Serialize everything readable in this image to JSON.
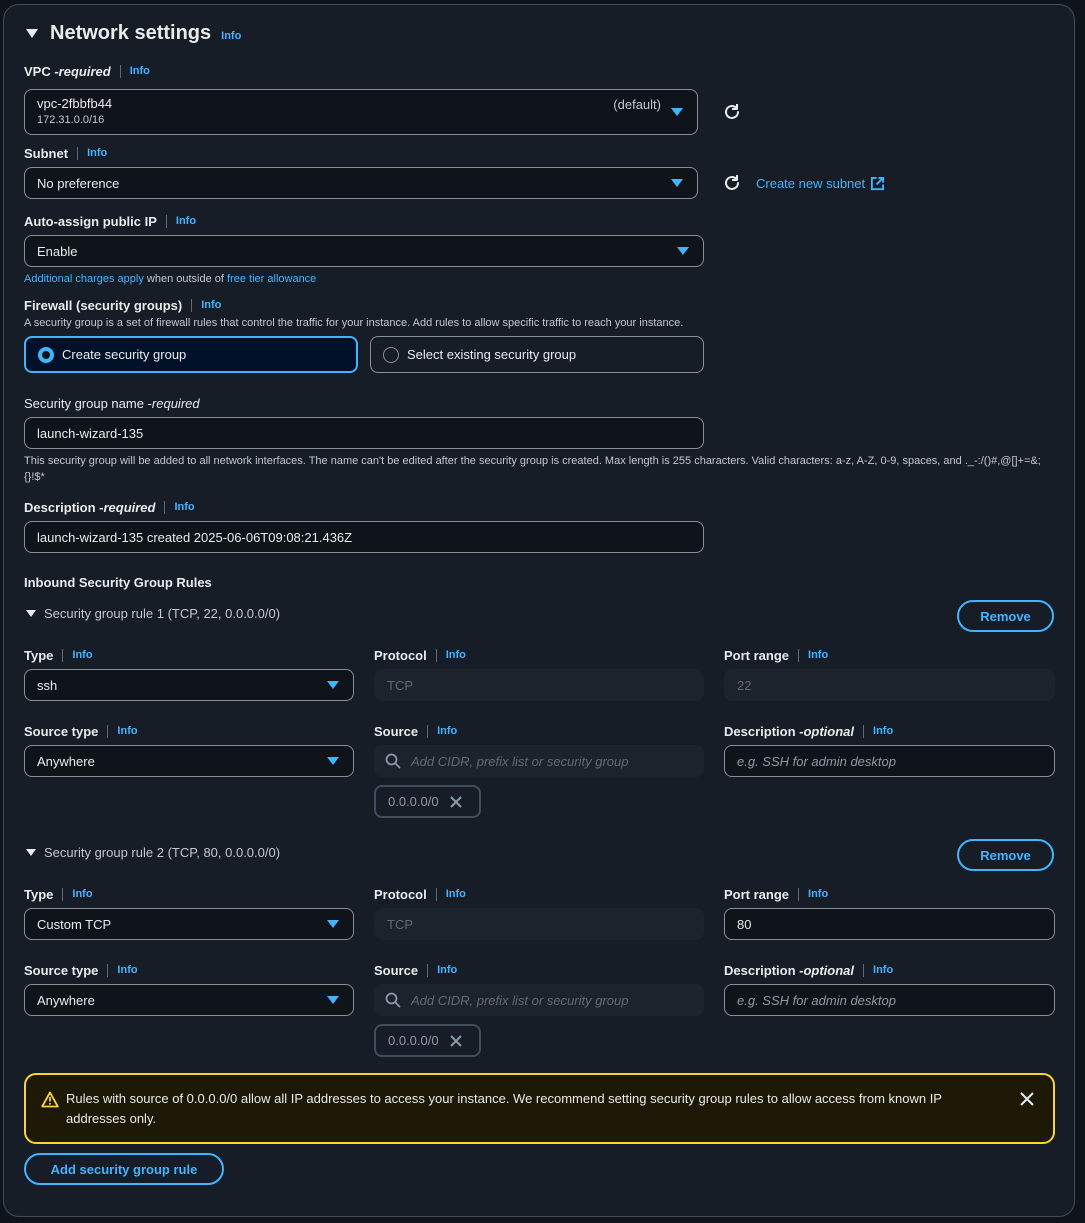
{
  "section": {
    "title": "Network settings",
    "info": "Info"
  },
  "vpc": {
    "label": "VPC - ",
    "label_em": "required",
    "info": "Info",
    "value": "vpc-2fbbfb44",
    "cidr": "172.31.0.0/16",
    "tag": "(default)"
  },
  "subnet": {
    "label": "Subnet",
    "info": "Info",
    "value": "No preference",
    "create_link": "Create new subnet"
  },
  "public_ip": {
    "label": "Auto-assign public IP",
    "info": "Info",
    "value": "Enable",
    "note_link1": "Additional charges apply",
    "note_mid": " when outside of ",
    "note_link2": "free tier allowance"
  },
  "firewall": {
    "label": "Firewall (security groups)",
    "info": "Info",
    "description": "A security group is a set of firewall rules that control the traffic for your instance. Add rules to allow specific traffic to reach your instance.",
    "option_create": "Create security group",
    "option_existing": "Select existing security group",
    "selected": "Create security group"
  },
  "sg_name": {
    "label": "Security group name - ",
    "label_em": "required",
    "value": "launch-wizard-135",
    "help": "This security group will be added to all network interfaces. The name can't be edited after the security group is created. Max length is 255 characters. Valid characters: a-z, A-Z, 0-9, spaces, and ._-:/()#,@[]+=&;{}!$*"
  },
  "sg_desc": {
    "label": "Description - ",
    "label_em": "required",
    "info": "Info",
    "value": "launch-wizard-135 created 2025-06-06T09:08:21.436Z"
  },
  "inbound": {
    "title": "Inbound Security Group Rules",
    "rules": [
      {
        "header": "Security group rule 1 (TCP, 22, 0.0.0.0/0)",
        "remove": "Remove",
        "type_label": "Type",
        "type_value": "ssh",
        "protocol_label": "Protocol",
        "protocol_value": "TCP",
        "port_label": "Port range",
        "port_value": "22",
        "source_type_label": "Source type",
        "source_type_value": "Anywhere",
        "source_label": "Source",
        "source_placeholder": "Add CIDR, prefix list or security group",
        "desc_label": "Description - ",
        "desc_em": "optional",
        "desc_placeholder": "e.g. SSH for admin desktop",
        "token": "0.0.0.0/0",
        "info": "Info"
      },
      {
        "header": "Security group rule 2 (TCP, 80, 0.0.0.0/0)",
        "remove": "Remove",
        "type_label": "Type",
        "type_value": "Custom TCP",
        "protocol_label": "Protocol",
        "protocol_value": "TCP",
        "port_label": "Port range",
        "port_value": "80",
        "source_type_label": "Source type",
        "source_type_value": "Anywhere",
        "source_label": "Source",
        "source_placeholder": "Add CIDR, prefix list or security group",
        "desc_label": "Description - ",
        "desc_em": "optional",
        "desc_placeholder": "e.g. SSH for admin desktop",
        "token": "0.0.0.0/0",
        "info": "Info"
      }
    ]
  },
  "warning": {
    "text": "Rules with source of 0.0.0.0/0 allow all IP addresses to access your instance. We recommend setting security group rules to allow access from known IP addresses only."
  },
  "add_rule": "Add security group rule",
  "colors": {
    "accent": "#42b4ff",
    "warning": "#fbd332",
    "background": "#161d26"
  }
}
